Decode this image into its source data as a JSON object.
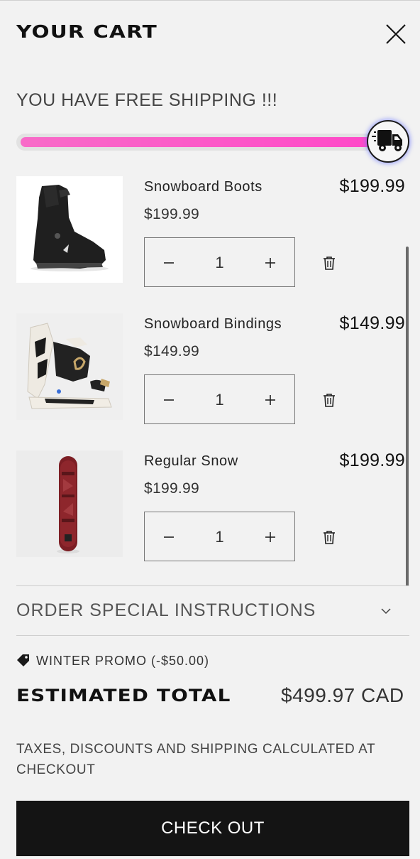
{
  "header": {
    "title": "YOUR CART",
    "close_icon": "close-icon"
  },
  "shipping": {
    "message": "YOU HAVE FREE SHIPPING !!!",
    "progress": 1.0,
    "truck_icon": "fast-delivery-truck-icon"
  },
  "items": [
    {
      "name": "Snowboard Boots",
      "unit_price": "$199.99",
      "line_price": "$199.99",
      "quantity": "1"
    },
    {
      "name": "Snowboard Bindings",
      "unit_price": "$149.99",
      "line_price": "$149.99",
      "quantity": "1"
    },
    {
      "name": "Regular Snow",
      "unit_price": "$199.99",
      "line_price": "$199.99",
      "quantity": "1"
    }
  ],
  "instructions": {
    "label": "ORDER SPECIAL INSTRUCTIONS"
  },
  "promo": {
    "label": "WINTER PROMO (-$50.00)"
  },
  "total": {
    "label": "ESTIMATED TOTAL",
    "value": "$499.97 CAD"
  },
  "tax_note": "TAXES, DISCOUNTS AND SHIPPING CALCULATED AT CHECKOUT",
  "checkout": {
    "label": "CHECK OUT"
  },
  "colors": {
    "progress_start": "#f86bc8",
    "progress_end": "#ff48c8",
    "checkout_bg": "#141414",
    "background": "#f2f2f2"
  }
}
